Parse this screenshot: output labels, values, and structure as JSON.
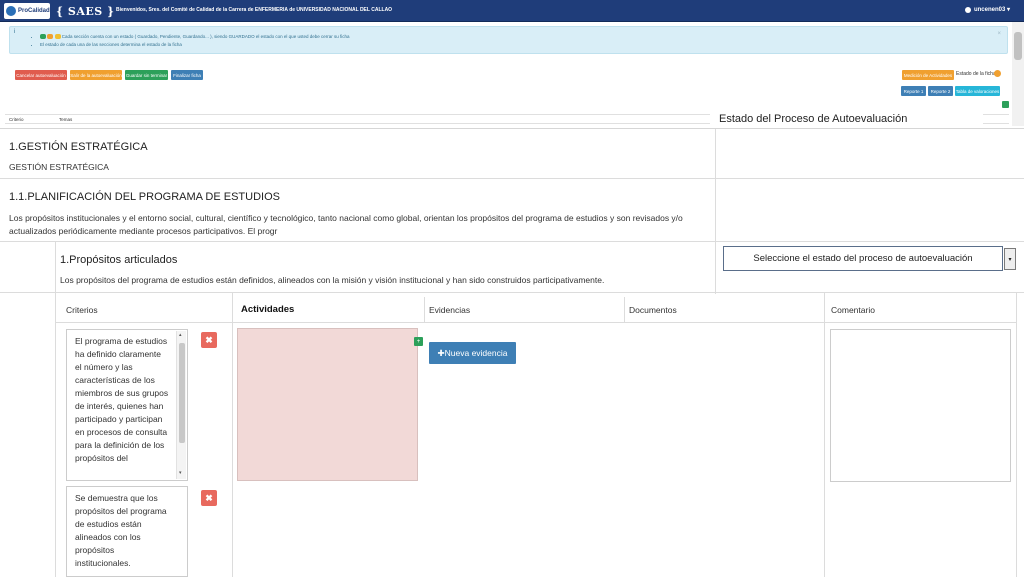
{
  "navbar": {
    "brand_logo_text": "ProCalidad",
    "brand_name": "{ SAES }",
    "welcome": "Bienvenidos, Sres. del Comité de Calidad de la Carrera de ENFERMERIA de UNIVERSIDAD NACIONAL DEL CALLAO",
    "user": "uncenen03 ▾"
  },
  "alert": {
    "icon": "i",
    "line1": "Cada sección cuenta con un estado ( Guardado, Pendiente, Guardando... ), siendo GUARDADO el estado con el que usted debe cerrar su ficha",
    "line2": "El estado de cada una de las secciones determina el estado de la ficha",
    "close": "×",
    "colors": {
      "saved": "#2ca05a",
      "pending": "#f0a030",
      "saving": "#f0c030"
    }
  },
  "actions": {
    "cancel": "Cancelar autoevaluación",
    "exit": "Salir de la autoevaluación",
    "save": "Guardar sin terminar",
    "finish": "Finalizar ficha",
    "activities": "Medición de Actividades",
    "status_label": "Estado de la ficha:",
    "report1": "Reporte 1",
    "report2": "Reporte 2",
    "valuation": "Tabla de valoraciones"
  },
  "mini_header": {
    "col1": "Criterio",
    "col2": "Temas"
  },
  "overlay_title": "Estado del Proceso de Autoevaluación",
  "section": {
    "title": "1.GESTIÓN ESTRATÉGICA",
    "subtitle": "GESTIÓN ESTRATÉGICA",
    "plan_title": "1.1.PLANIFICACIÓN DEL PROGRAMA DE ESTUDIOS",
    "plan_desc": "Los propósitos institucionales y el entorno social, cultural, científico y tecnológico, tanto nacional como global, orientan los propósitos del programa de estudios y son revisados y/o actualizados periódicamente mediante procesos participativos. El progr",
    "sub_title": "1.Propósitos articulados",
    "sub_desc": "Los propósitos del programa de estudios están definidos, alineados con la misión y visión institucional y han sido construidos participativamente.",
    "status_select": "Seleccione el estado del proceso de autoevaluación",
    "select_arrow": "▾"
  },
  "table": {
    "headers": [
      "Criterios",
      "Actividades",
      "Evidencias",
      "Documentos",
      "Comentario"
    ],
    "criteria": [
      "El programa de estudios ha definido claramente el número y las características de los miembros de sus grupos de interés, quienes han participado y participan en procesos de consulta para la definición de los propósitos del",
      "Se demuestra que los propósitos del programa de estudios están alineados con los propósitos institucionales."
    ],
    "delete_icon": "✖",
    "add_icon": "+",
    "new_evidence": "✚Nueva evidencia"
  }
}
